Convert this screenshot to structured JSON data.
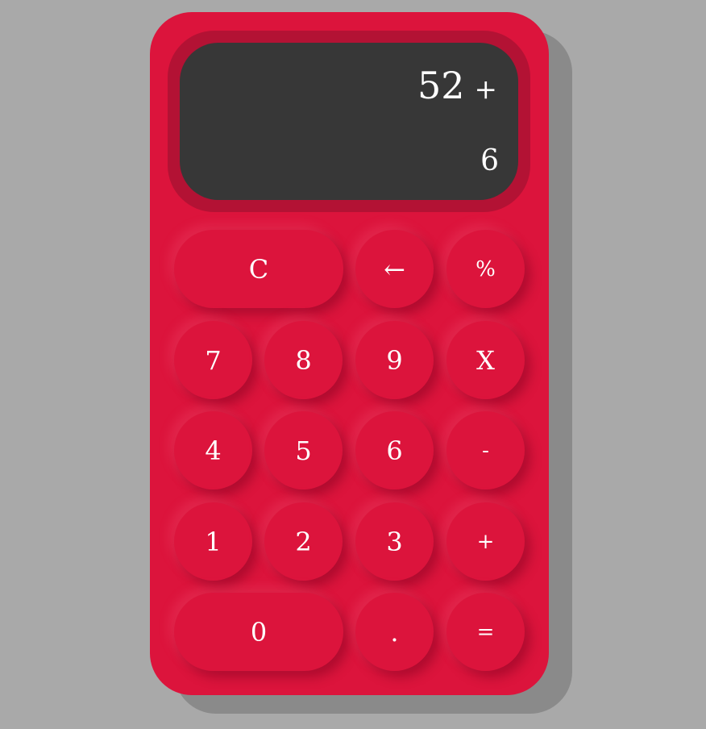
{
  "display": {
    "previous_operand": "52",
    "operator": "+",
    "current_operand": "6"
  },
  "buttons": {
    "clear": "C",
    "backspace": "←",
    "percent": "%",
    "seven": "7",
    "eight": "8",
    "nine": "9",
    "multiply": "X",
    "four": "4",
    "five": "5",
    "six": "6",
    "subtract": "-",
    "one": "1",
    "two": "2",
    "three": "3",
    "add": "+",
    "zero": "0",
    "decimal": ".",
    "equals": "="
  },
  "colors": {
    "body": "#dc143c",
    "screen_frame": "#b31234",
    "screen": "#373737",
    "text": "#ffffff",
    "background": "#a9a9a9"
  }
}
